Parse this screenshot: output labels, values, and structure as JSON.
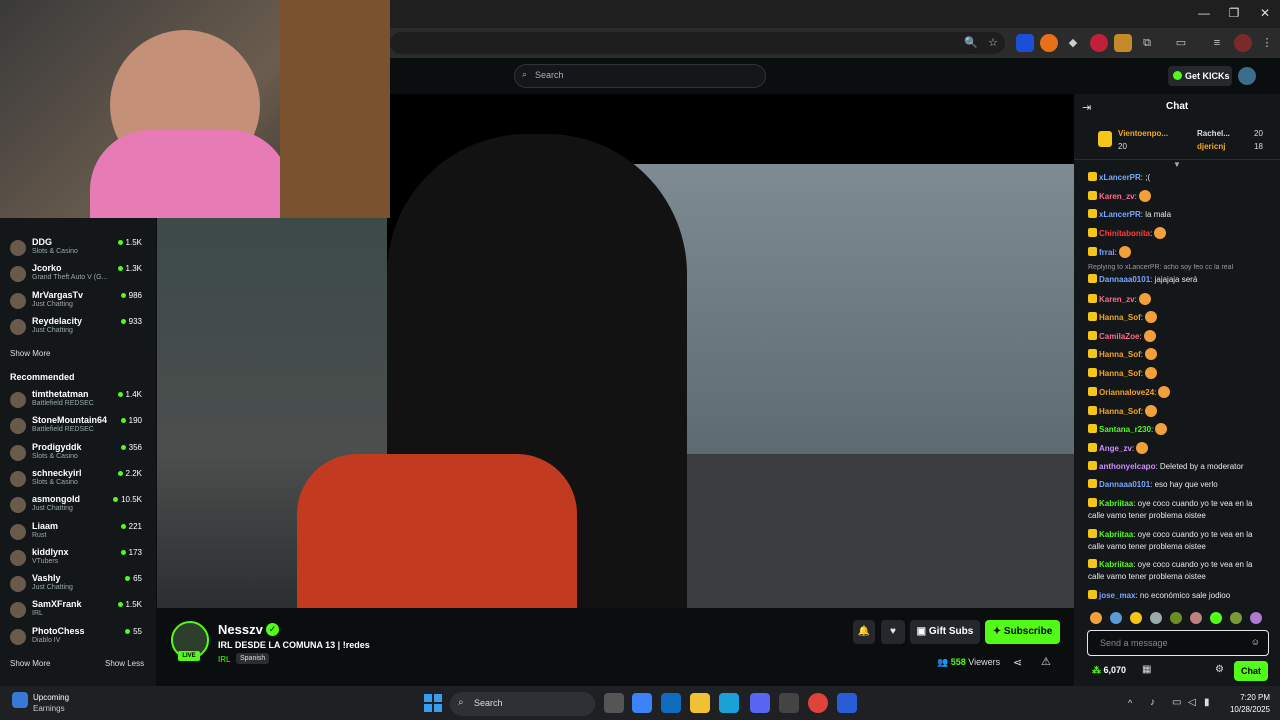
{
  "browser": {
    "window_controls": {
      "minimize": "—",
      "restore": "❐",
      "close": "✕"
    }
  },
  "header": {
    "search_placeholder": "Search",
    "get_kicks": "Get KICKs"
  },
  "sidebar": {
    "following": [
      {
        "name": "DDG",
        "category": "Slots & Casino",
        "viewers": "1.5K"
      },
      {
        "name": "Jcorko",
        "category": "Grand Theft Auto V (G...",
        "viewers": "1.3K"
      },
      {
        "name": "MrVargasTv",
        "category": "Just Chatting",
        "viewers": "986"
      },
      {
        "name": "Reydelacity",
        "category": "Just Chatting",
        "viewers": "933"
      }
    ],
    "show_more_1": "Show More",
    "recommended_label": "Recommended",
    "recommended": [
      {
        "name": "timthetatman",
        "category": "Battlefield REDSEC",
        "viewers": "1.4K"
      },
      {
        "name": "StoneMountain64",
        "category": "Battlefield REDSEC",
        "viewers": "190"
      },
      {
        "name": "Prodigyddk",
        "category": "Slots & Casino",
        "viewers": "356"
      },
      {
        "name": "schneckyirl",
        "category": "Slots & Casino",
        "viewers": "2.2K"
      },
      {
        "name": "asmongold",
        "category": "Just Chatting",
        "viewers": "10.5K"
      },
      {
        "name": "Liaam",
        "category": "Rust",
        "viewers": "221"
      },
      {
        "name": "kiddlynx",
        "category": "VTubers",
        "viewers": "173"
      },
      {
        "name": "Vashly",
        "category": "Just Chatting",
        "viewers": "65"
      },
      {
        "name": "SamXFrank",
        "category": "IRL",
        "viewers": "1.5K"
      },
      {
        "name": "PhotoChess",
        "category": "Diablo IV",
        "viewers": "55"
      }
    ],
    "show_more_2": "Show More",
    "show_less": "Show Less"
  },
  "stream": {
    "streamer": "Nesszv",
    "title": "IRL DESDE LA COMUNA 13 | !redes",
    "category": "IRL",
    "tag": "Spanish",
    "live": "LIVE",
    "viewers": "558",
    "viewers_label": "Viewers",
    "gift_subs": "Gift Subs",
    "subscribe": "Subscribe"
  },
  "chat": {
    "title": "Chat",
    "pinned": [
      {
        "name": "Vientoenpo...",
        "value": "20"
      },
      {
        "name": "Rachel...",
        "value": "20"
      },
      {
        "name": "djericnj",
        "value": "18"
      }
    ],
    "messages": [
      {
        "user": "xLancerPR",
        "text": ": ;(",
        "color": "#7aa7ff"
      },
      {
        "user": "Karen_zv",
        "text": ":",
        "color": "#ff6a8a"
      },
      {
        "user": "xLancerPR",
        "text": ": la mala",
        "color": "#7aa7ff"
      },
      {
        "user": "Chinitabonita",
        "text": ":",
        "color": "#ff3b3b"
      },
      {
        "user": "frrai",
        "text": ":",
        "color": "#7aa7ff"
      },
      {
        "user": "Dannaaa0101",
        "text": ": jajajaja será",
        "color": "#7aa7ff"
      },
      {
        "user": "Karen_zv",
        "text": ":",
        "color": "#ff6a8a"
      },
      {
        "user": "Hanna_Sof",
        "text": ":",
        "color": "#f5a623"
      },
      {
        "user": "CamilaZoe",
        "text": ":",
        "color": "#ff6a8a"
      },
      {
        "user": "Hanna_Sof",
        "text": ":",
        "color": "#f5a623"
      },
      {
        "user": "Hanna_Sof",
        "text": ":",
        "color": "#f5a623"
      },
      {
        "user": "Oriannalove24",
        "text": ":",
        "color": "#f5a623"
      },
      {
        "user": "Hanna_Sof",
        "text": ":",
        "color": "#f5a623"
      },
      {
        "user": "Santana_r230",
        "text": ":",
        "color": "#53fc18"
      },
      {
        "user": "Ange_zv",
        "text": ":",
        "color": "#d08cff"
      },
      {
        "user": "anthonyelcapo",
        "text": ": Deleted by a moderator",
        "color": "#d08cff"
      },
      {
        "user": "Dannaaa0101",
        "text": ": eso hay que verlo",
        "color": "#7aa7ff"
      },
      {
        "user": "Kabriitaa",
        "text": ": oye coco cuando yo te vea en la calle vamo tener problema oistee",
        "color": "#53fc18"
      },
      {
        "user": "Kabriitaa",
        "text": ": oye coco cuando yo te vea en la calle vamo tener problema oistee",
        "color": "#53fc18"
      },
      {
        "user": "Kabriitaa",
        "text": ": oye coco cuando yo te vea en la calle vamo tener problema oistee",
        "color": "#53fc18"
      },
      {
        "user": "jose_max",
        "text": ": no económico sale jodioo",
        "color": "#7aa7ff"
      }
    ],
    "reply_line": "Replying to xLancerPR: acho soy feo cc la real",
    "input_placeholder": "Send a message",
    "kicks": "6,070",
    "chat_button": "Chat"
  },
  "taskbar": {
    "weather_title": "Upcoming",
    "weather_sub": "Earnings",
    "search": "Search",
    "time": "7:20 PM",
    "date": "10/28/2025"
  },
  "colors": {
    "accent": "#53fc18",
    "bg": "#0b0e0f",
    "panel": "#14171a"
  }
}
